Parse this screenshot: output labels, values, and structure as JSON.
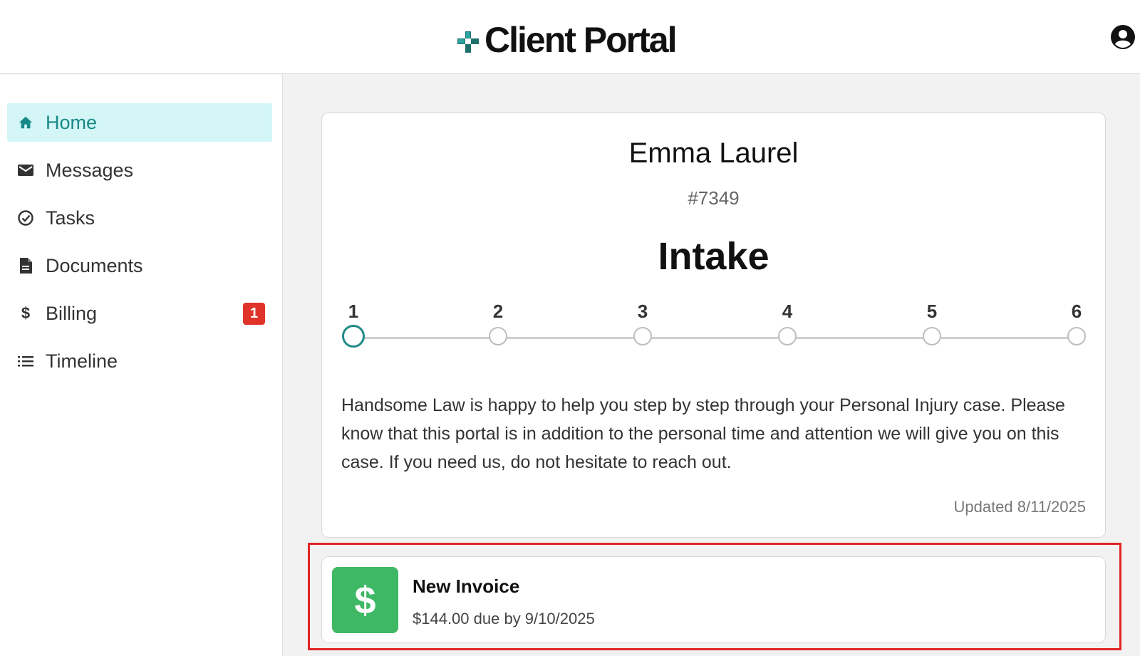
{
  "header": {
    "app_title": "Client Portal",
    "logo_icon": "cross-logo-icon",
    "account_icon": "user-account-icon"
  },
  "sidebar": {
    "items": [
      {
        "label": "Home",
        "icon": "home-icon",
        "active": true
      },
      {
        "label": "Messages",
        "icon": "mail-icon"
      },
      {
        "label": "Tasks",
        "icon": "check-circle-icon"
      },
      {
        "label": "Documents",
        "icon": "document-icon"
      },
      {
        "label": "Billing",
        "icon": "dollar-icon",
        "badge": "1"
      },
      {
        "label": "Timeline",
        "icon": "list-icon"
      }
    ]
  },
  "case": {
    "client_name": "Emma Laurel",
    "case_number": "#7349",
    "stage": "Intake",
    "steps": [
      "1",
      "2",
      "3",
      "4",
      "5",
      "6"
    ],
    "current_step": 1,
    "intro": "Handsome Law is happy to help you step by step through your Personal Injury case. Please know that this portal is in addition to the personal time and attention we will give you on this case. If you need us, do not hesitate to reach out.",
    "updated": "Updated 8/11/2025"
  },
  "invoice": {
    "icon_glyph": "$",
    "title": "New Invoice",
    "subtitle": "$144.00 due by 9/10/2025"
  },
  "colors": {
    "accent": "#1f8a88",
    "active_nav_bg": "#d4f6f7",
    "badge": "#e0342b",
    "invoice_icon_bg": "#3fb865",
    "highlight_border": "#e02424"
  }
}
